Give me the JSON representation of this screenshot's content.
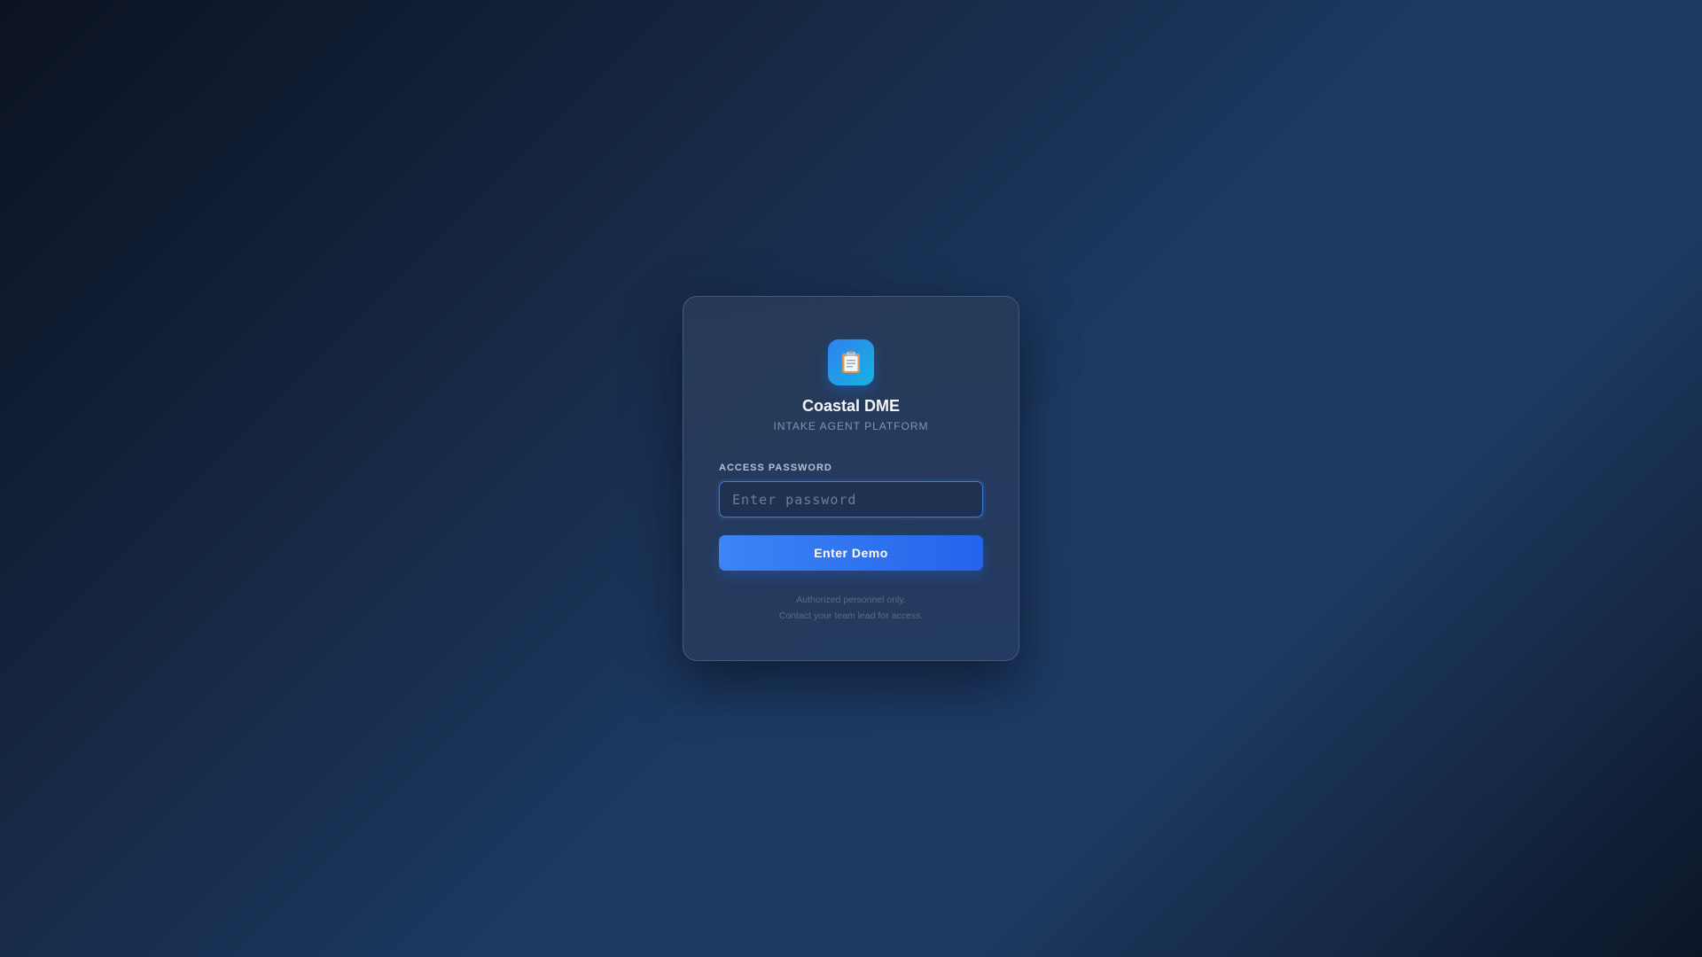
{
  "brand": {
    "title": "Coastal DME",
    "subtitle": "INTAKE AGENT PLATFORM",
    "icon": "clipboard-icon"
  },
  "form": {
    "label": "ACCESS PASSWORD",
    "placeholder": "Enter password",
    "value": "",
    "submit_label": "Enter Demo"
  },
  "footer": {
    "line1": "Authorized personnel only.",
    "line2": "Contact your team lead for access."
  },
  "colors": {
    "accent": "#2563eb",
    "logo_gradient_start": "#2f80f0",
    "logo_gradient_end": "#18b4e0"
  }
}
